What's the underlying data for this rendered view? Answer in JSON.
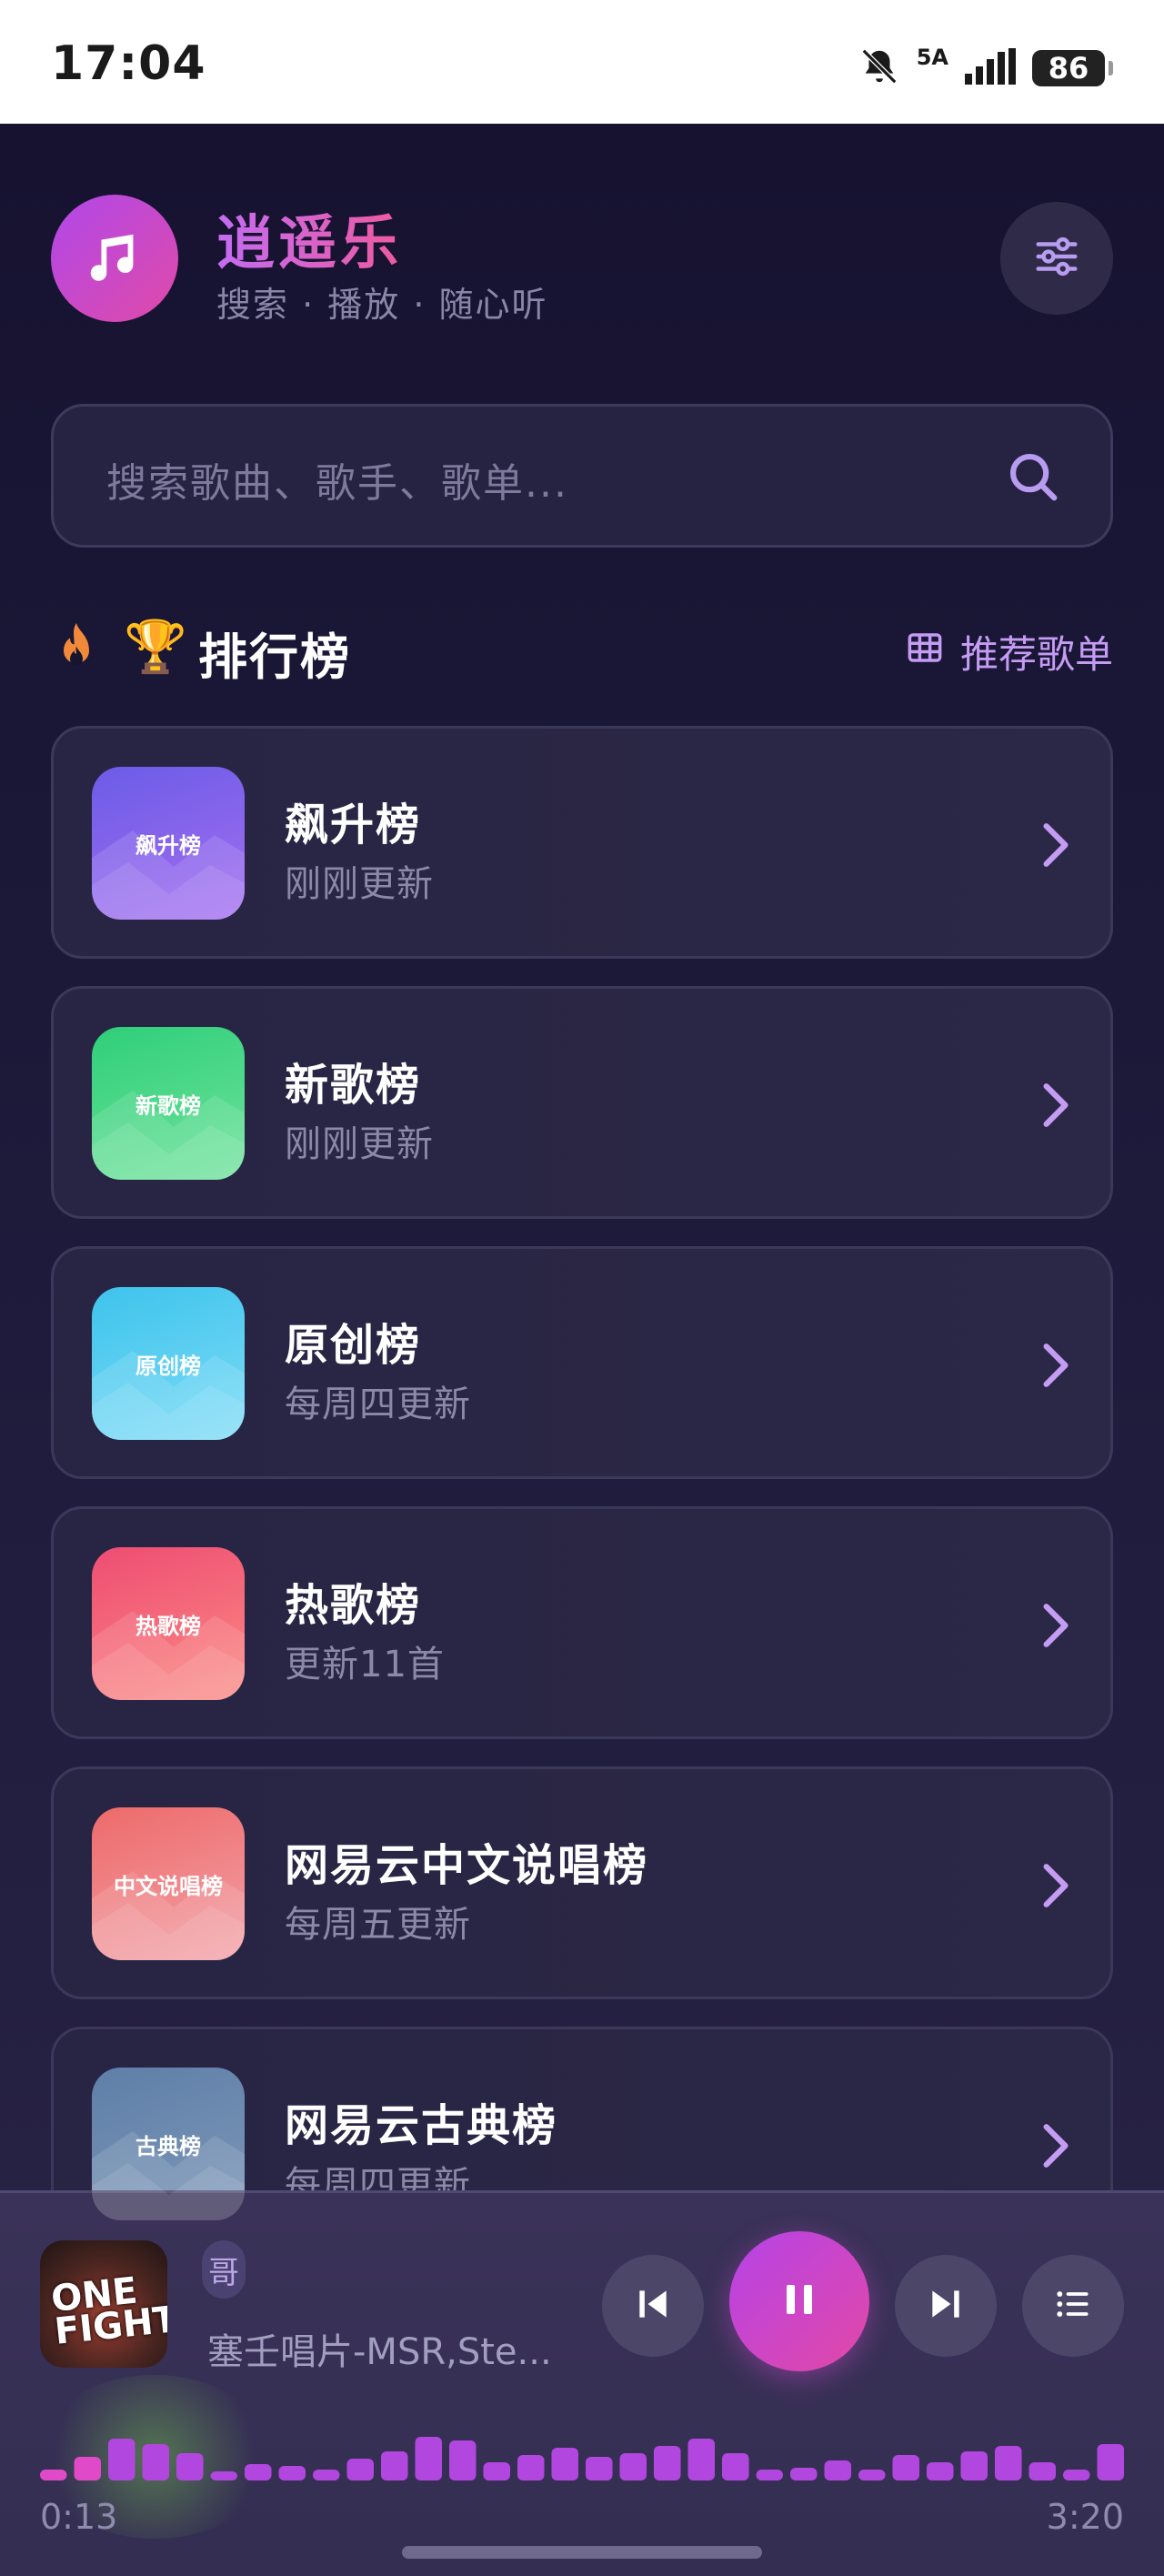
{
  "status_bar": {
    "time": "17:04",
    "network": "5A",
    "battery": "86",
    "icons": [
      "bell-muted-icon",
      "signal-icon",
      "battery-icon"
    ]
  },
  "header": {
    "title": "逍遥乐",
    "subtitle": "搜索 · 播放 · 随心听",
    "logo_icon": "music-note-icon",
    "settings_icon": "sliders-icon"
  },
  "search": {
    "placeholder": "搜索歌曲、歌手、歌单...",
    "icon": "search-icon"
  },
  "section": {
    "fire_icon": "fire-icon",
    "emoji": "🏆",
    "title": "排行榜",
    "link_label": "推荐歌单",
    "link_icon": "grid-icon"
  },
  "charts": [
    {
      "cover_label": "飙升榜",
      "title": "飙升榜",
      "subtitle": "刚刚更新",
      "color_a": "#6b5ce7",
      "color_b": "#a46ef0"
    },
    {
      "cover_label": "新歌榜",
      "title": "新歌榜",
      "subtitle": "刚刚更新",
      "color_a": "#2fcf7a",
      "color_b": "#6fe29b"
    },
    {
      "cover_label": "原创榜",
      "title": "原创榜",
      "subtitle": "每周四更新",
      "color_a": "#3ec3ec",
      "color_b": "#7ddcf7"
    },
    {
      "cover_label": "热歌榜",
      "title": "热歌榜",
      "subtitle": "更新11首",
      "color_a": "#ee4d72",
      "color_b": "#fb8a84"
    },
    {
      "cover_label": "中文说唱榜",
      "title": "网易云中文说唱榜",
      "subtitle": "每周五更新",
      "color_a": "#ee6a6a",
      "color_b": "#f2a2a8"
    },
    {
      "cover_label": "古典榜",
      "title": "网易云古典榜",
      "subtitle": "每周四更新",
      "color_a": "#5f7fa8",
      "color_b": "#7d97b8"
    }
  ],
  "player": {
    "album_art_text": "ONE FIGHT",
    "title_fragment": "哥",
    "artist": "塞壬唱片-MSR,Ste...",
    "elapsed": "0:13",
    "duration": "3:20",
    "progress": 0.065,
    "controls": [
      "skip-previous-icon",
      "pause-icon",
      "skip-next-icon",
      "playlist-icon"
    ],
    "accent": "#c84bd8"
  }
}
